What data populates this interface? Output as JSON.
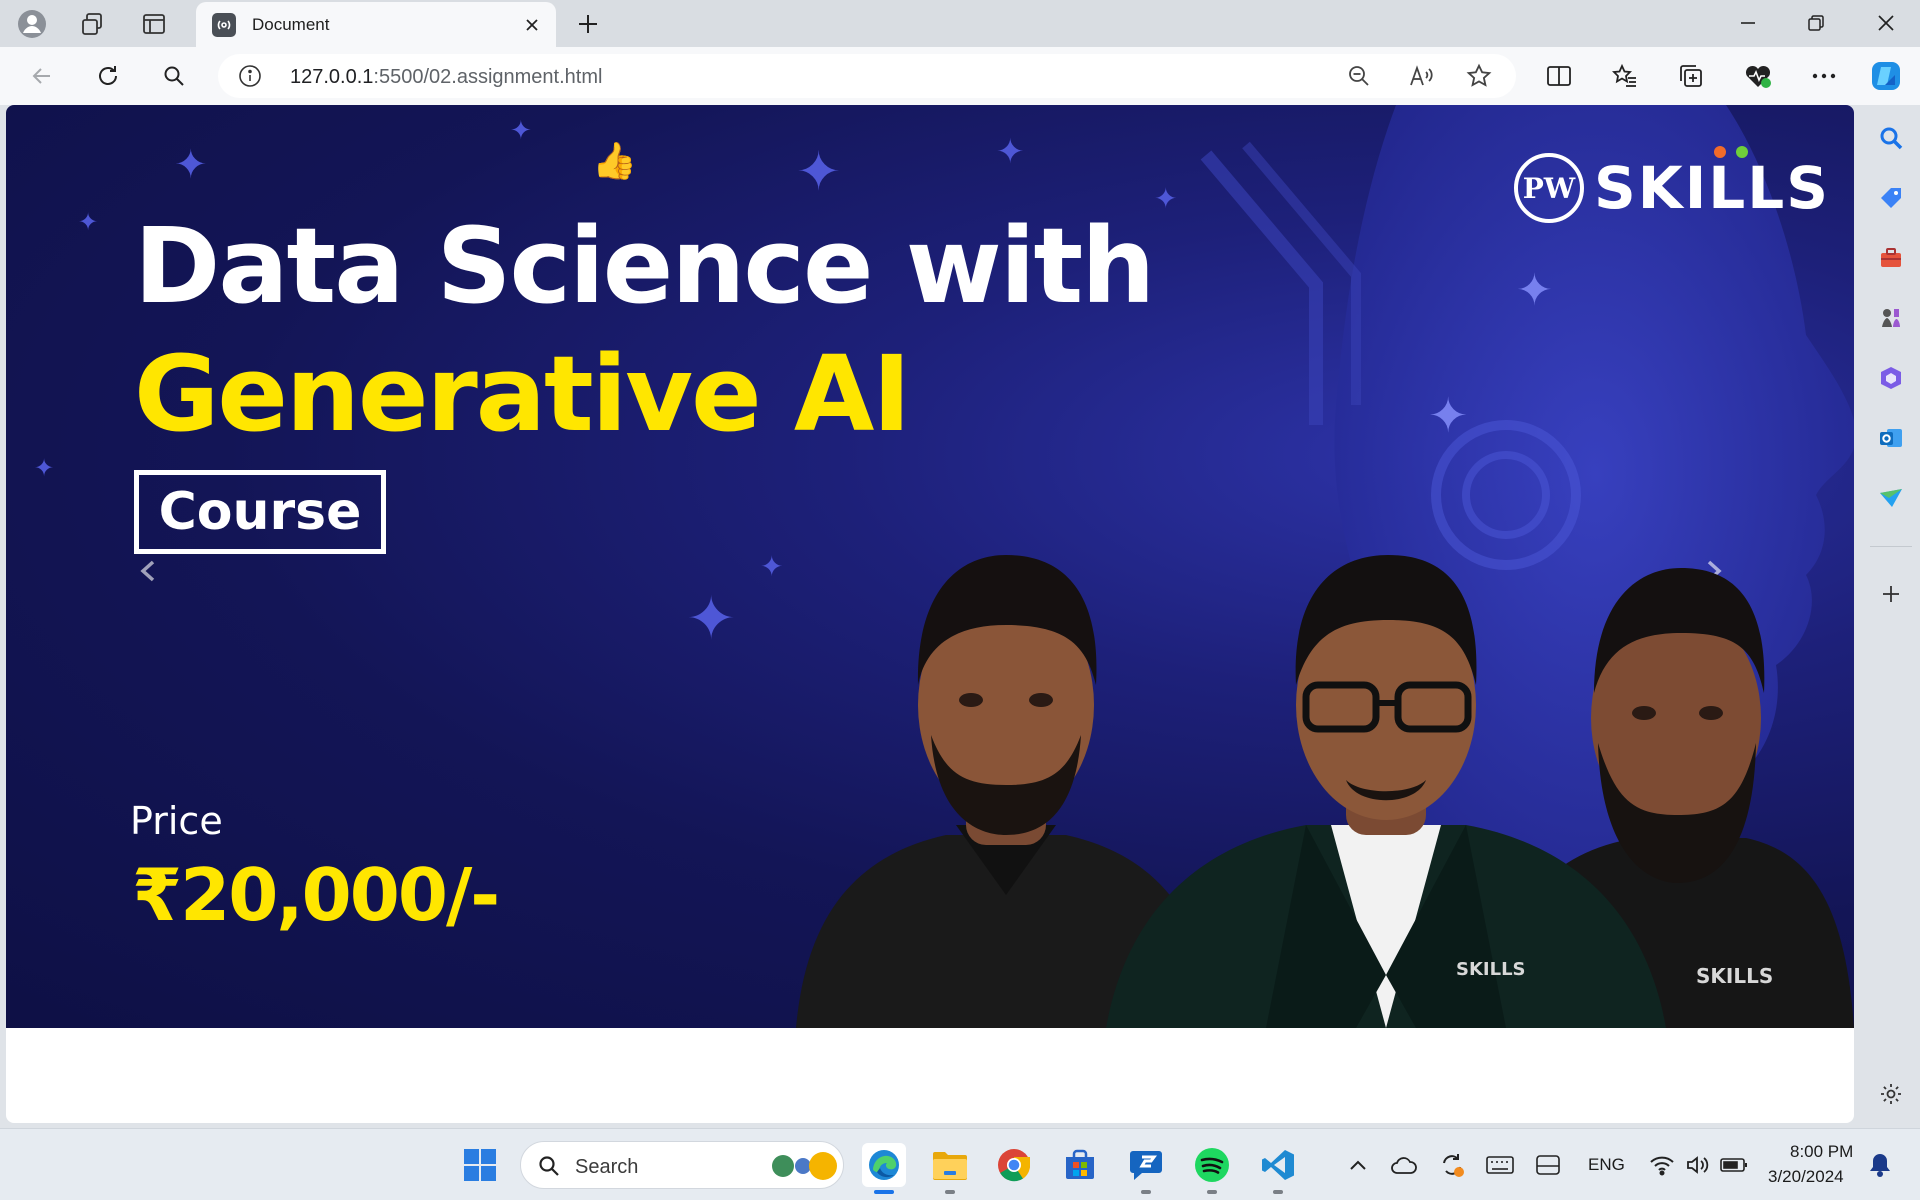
{
  "browser": {
    "tab": {
      "title": "Document"
    },
    "address": {
      "url_host": "127.0.0.1",
      "url_rest": ":5500/02.assignment.html"
    }
  },
  "banner": {
    "title_line1": "Data Science with",
    "title_line2": "Generative AI",
    "course_label": "Course",
    "price_label": "Price",
    "price_value": "₹20,000/-",
    "logo_text": "SKILLS",
    "logo_seal": "PW",
    "shirt_logo_1": "SKILLS",
    "shirt_logo_2": "SKILLS",
    "colors": {
      "background": "#131556",
      "accent_yellow": "#ffe600",
      "text_white": "#ffffff"
    }
  },
  "taskbar": {
    "search_label": "Search",
    "language": "ENG",
    "time": "8:00 PM",
    "date": "3/20/2024"
  }
}
